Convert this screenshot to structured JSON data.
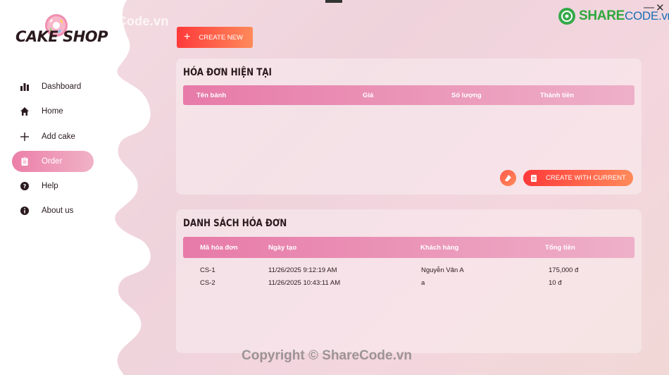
{
  "app": {
    "logo_text": "CAKE SHOP",
    "accent": "#ec7fa8",
    "button_gradient": [
      "#ff3a3a",
      "#ff8a5a"
    ]
  },
  "window": {
    "minimize": "—",
    "close": "✕"
  },
  "watermark": {
    "top": "ShareCode.vn",
    "bottom": "Copyright © ShareCode.vn",
    "brand_share": "SHARE",
    "brand_code": "CODE.vn"
  },
  "sidebar": {
    "items": [
      {
        "label": "Dashboard",
        "icon": "bar-chart-icon"
      },
      {
        "label": "Home",
        "icon": "home-icon"
      },
      {
        "label": "Add cake",
        "icon": "plus-icon"
      },
      {
        "label": "Order",
        "icon": "order-icon",
        "active": true
      },
      {
        "label": "Help",
        "icon": "help-icon"
      },
      {
        "label": "About us",
        "icon": "info-icon"
      }
    ]
  },
  "toolbar": {
    "create_new_label": "CREATE NEW"
  },
  "current_invoice": {
    "title": "HÓA ĐƠN HIỆN TẠI",
    "columns": [
      "Tên bánh",
      "Giá",
      "Số lượng",
      "Thành tiền"
    ],
    "rows": [],
    "create_with_current_label": "CREATE WITH CURRENT"
  },
  "invoice_list": {
    "title": "DANH SÁCH HÓA ĐƠN",
    "columns": [
      "Mã hóa đơn",
      "Ngày tạo",
      "Khách hàng",
      "Tổng tiền"
    ],
    "rows": [
      [
        "CS-1",
        "11/26/2025 9:12:19 AM",
        "Nguyễn Văn A",
        "175,000 đ"
      ],
      [
        "CS-2",
        "11/26/2025 10:43:11 AM",
        "a",
        "10 đ"
      ]
    ]
  }
}
